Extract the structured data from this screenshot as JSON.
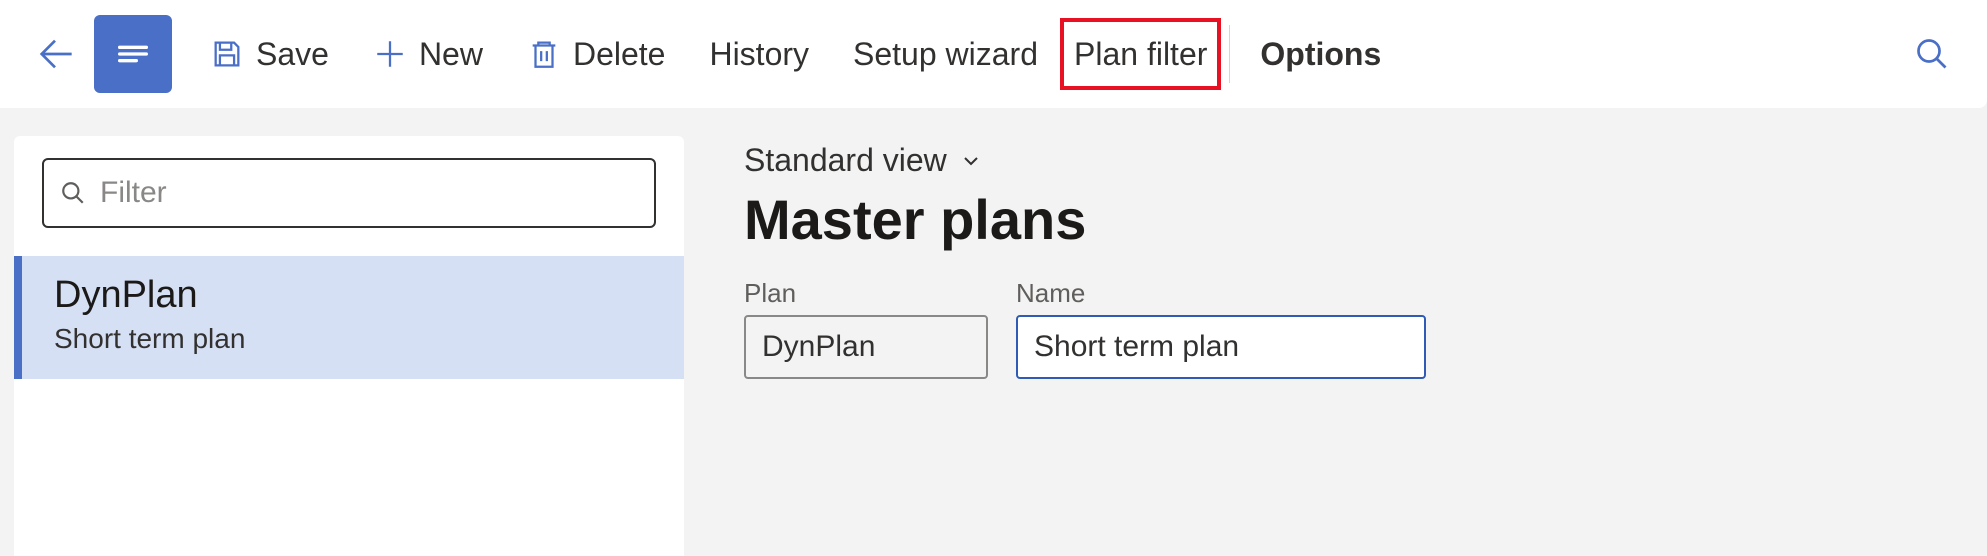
{
  "toolbar": {
    "save_label": "Save",
    "new_label": "New",
    "delete_label": "Delete",
    "history_label": "History",
    "setup_wizard_label": "Setup wizard",
    "plan_filter_label": "Plan filter",
    "options_label": "Options"
  },
  "list": {
    "filter_placeholder": "Filter",
    "items": [
      {
        "title": "DynPlan",
        "subtitle": "Short term plan"
      }
    ]
  },
  "detail": {
    "view_label": "Standard view",
    "page_title": "Master plans",
    "fields": {
      "plan_label": "Plan",
      "plan_value": "DynPlan",
      "name_label": "Name",
      "name_value": "Short term plan"
    }
  },
  "colors": {
    "accent": "#4a6fc7",
    "highlight": "#e81123"
  }
}
